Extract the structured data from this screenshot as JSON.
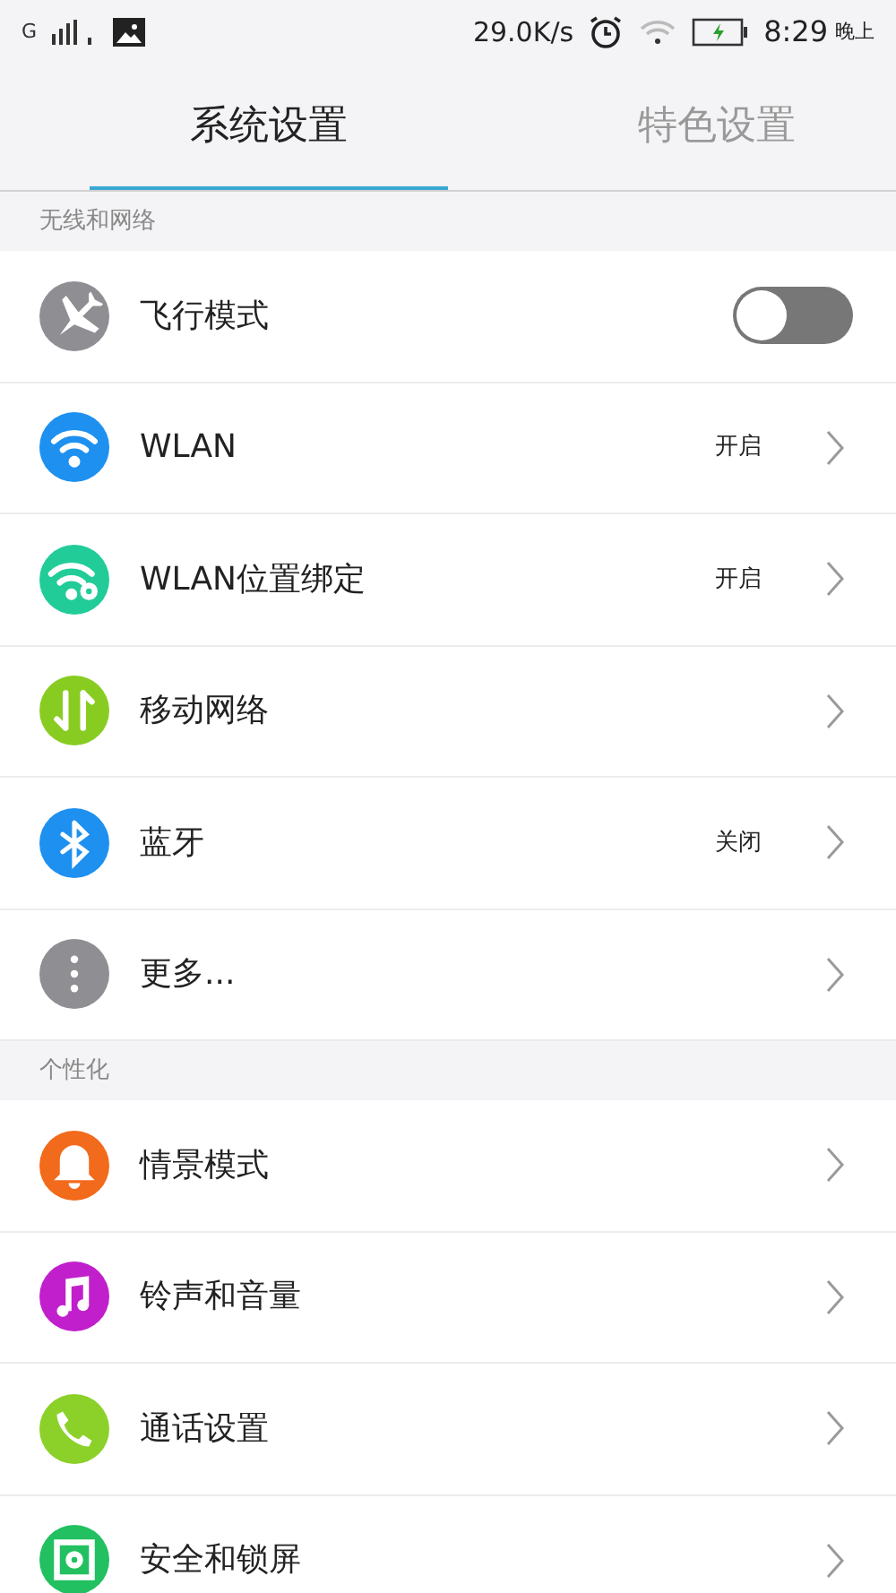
{
  "status_bar": {
    "network": "G",
    "speed": "29.0K/s",
    "time": "8:29",
    "period": "晚上"
  },
  "tabs": [
    {
      "label": "系统设置",
      "selected": true
    },
    {
      "label": "特色设置",
      "selected": false
    }
  ],
  "sections": [
    {
      "title": "无线和网络",
      "items": [
        {
          "kind": "toggle",
          "color": "#8e8e93",
          "label": "飞行模式",
          "on": false
        },
        {
          "kind": "link",
          "color": "#1e90f0",
          "label": "WLAN",
          "value": "开启"
        },
        {
          "kind": "link",
          "color": "#22cc99",
          "label": "WLAN位置绑定",
          "value": "开启"
        },
        {
          "kind": "link",
          "color": "#88cc22",
          "label": "移动网络"
        },
        {
          "kind": "link",
          "color": "#1e90f0",
          "label": "蓝牙",
          "value": "关闭"
        },
        {
          "kind": "link",
          "color": "#8e8e93",
          "label": "更多..."
        }
      ]
    },
    {
      "title": "个性化",
      "items": [
        {
          "kind": "link",
          "color": "#f26a1b",
          "label": "情景模式"
        },
        {
          "kind": "link",
          "color": "#c11fcc",
          "label": "铃声和音量"
        },
        {
          "kind": "link",
          "color": "#8cd02a",
          "label": "通话设置"
        },
        {
          "kind": "link",
          "color": "#22c060",
          "label": "安全和锁屏"
        }
      ]
    }
  ]
}
